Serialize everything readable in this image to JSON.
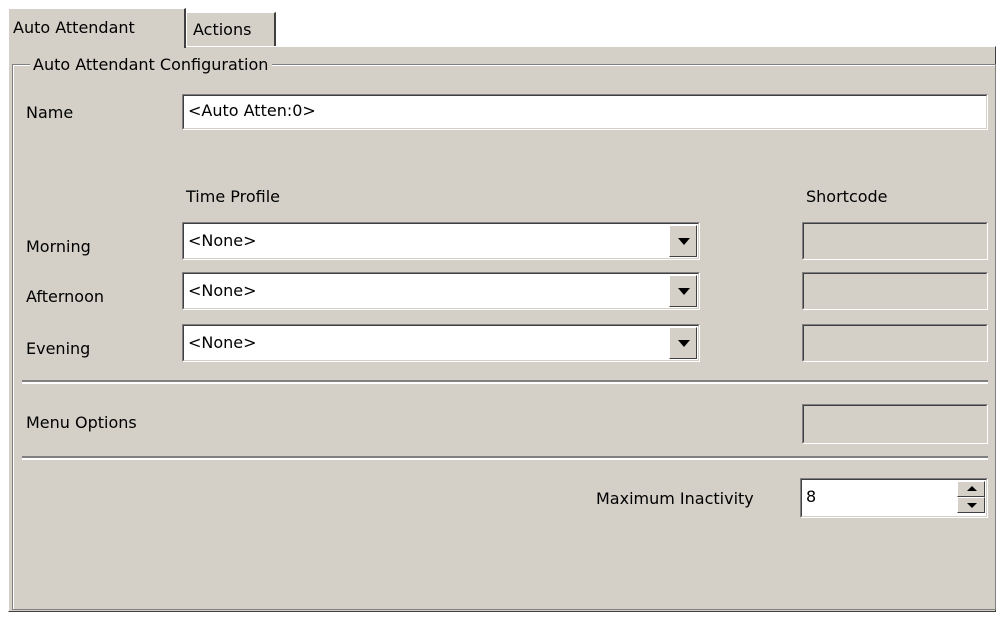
{
  "tabs": [
    {
      "label": "Auto Attendant",
      "active": true
    },
    {
      "label": "Actions",
      "active": false
    }
  ],
  "group_title": "Auto Attendant Configuration",
  "name": {
    "label": "Name",
    "value": "<Auto Atten:0>"
  },
  "headers": {
    "time_profile": "Time Profile",
    "shortcode": "Shortcode"
  },
  "rows": [
    {
      "label": "Morning",
      "time_profile": "<None>",
      "shortcode": ""
    },
    {
      "label": "Afternoon",
      "time_profile": "<None>",
      "shortcode": ""
    },
    {
      "label": "Evening",
      "time_profile": "<None>",
      "shortcode": ""
    }
  ],
  "menu_options": {
    "label": "Menu Options",
    "value": ""
  },
  "max_inactivity": {
    "label": "Maximum Inactivity",
    "value": "8"
  },
  "icons": [
    "dropdown-arrow-icon",
    "spin-up-icon",
    "spin-down-icon"
  ],
  "colors": {
    "panel": "#d4d0c8",
    "field": "#ffffff",
    "shadow": "#808080"
  }
}
